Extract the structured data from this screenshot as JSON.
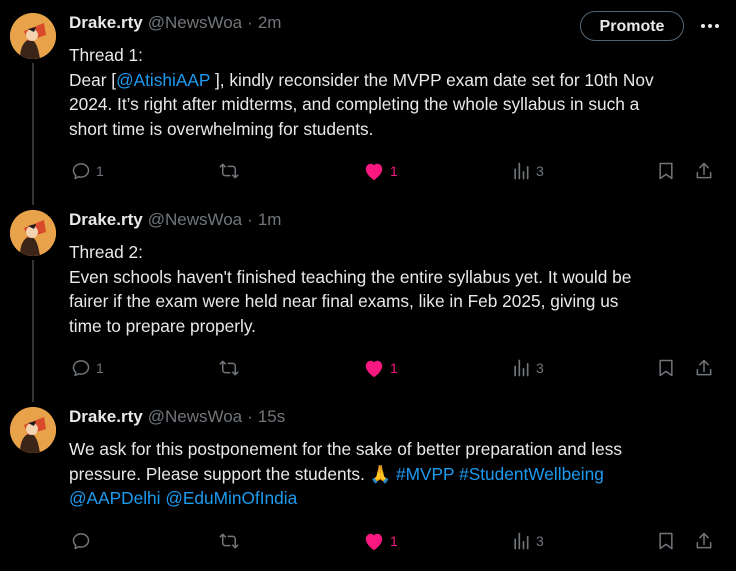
{
  "colors": {
    "background": "#000000",
    "text": "#e7e9ea",
    "muted": "#71767b",
    "link": "#1d9bf0",
    "like": "#f91880"
  },
  "tweets": [
    {
      "author": "Drake.rty",
      "handle": "@NewsWoa",
      "separator": "·",
      "time": "2m",
      "promote_label": "Promote",
      "body": {
        "l1": "Thread 1:",
        "l2_pre": "Dear [",
        "l2_mention": "@AtishiAAP",
        "l2_post": " ], kindly reconsider the MVPP exam date set for 10th Nov",
        "l3": "2024. It’s right after midterms, and completing the whole syllabus in such a",
        "l4": "short time is overwhelming for students."
      },
      "replies": "1",
      "reposts": "",
      "likes": "1",
      "views": "3"
    },
    {
      "author": "Drake.rty",
      "handle": "@NewsWoa",
      "separator": "·",
      "time": "1m",
      "body": {
        "l1": "Thread 2:",
        "l2": "Even schools haven't finished teaching the entire syllabus yet. It would be",
        "l3": "fairer if the exam were held near final exams, like in Feb 2025, giving us",
        "l4": "time to prepare properly."
      },
      "replies": "1",
      "reposts": "",
      "likes": "1",
      "views": "3"
    },
    {
      "author": "Drake.rty",
      "handle": "@NewsWoa",
      "separator": "·",
      "time": "15s",
      "body": {
        "l1": "We ask for this postponement for the sake of better preparation and less",
        "l2_pre": "pressure. Please support the students. 🙏 ",
        "l2_tag1": "#MVPP",
        "l2_tag2": "#StudentWellbeing",
        "l3_m1": "@AAPDelhi",
        "l3_m2": "@EduMinOfIndia"
      },
      "replies": "",
      "reposts": "",
      "likes": "1",
      "views": "3"
    }
  ],
  "icons": {
    "avatar": "avatar-illustration",
    "more": "more-icon",
    "reply": "reply-icon",
    "repost": "repost-icon",
    "like": "like-icon",
    "views": "views-icon",
    "bookmark": "bookmark-icon",
    "share": "share-icon"
  }
}
